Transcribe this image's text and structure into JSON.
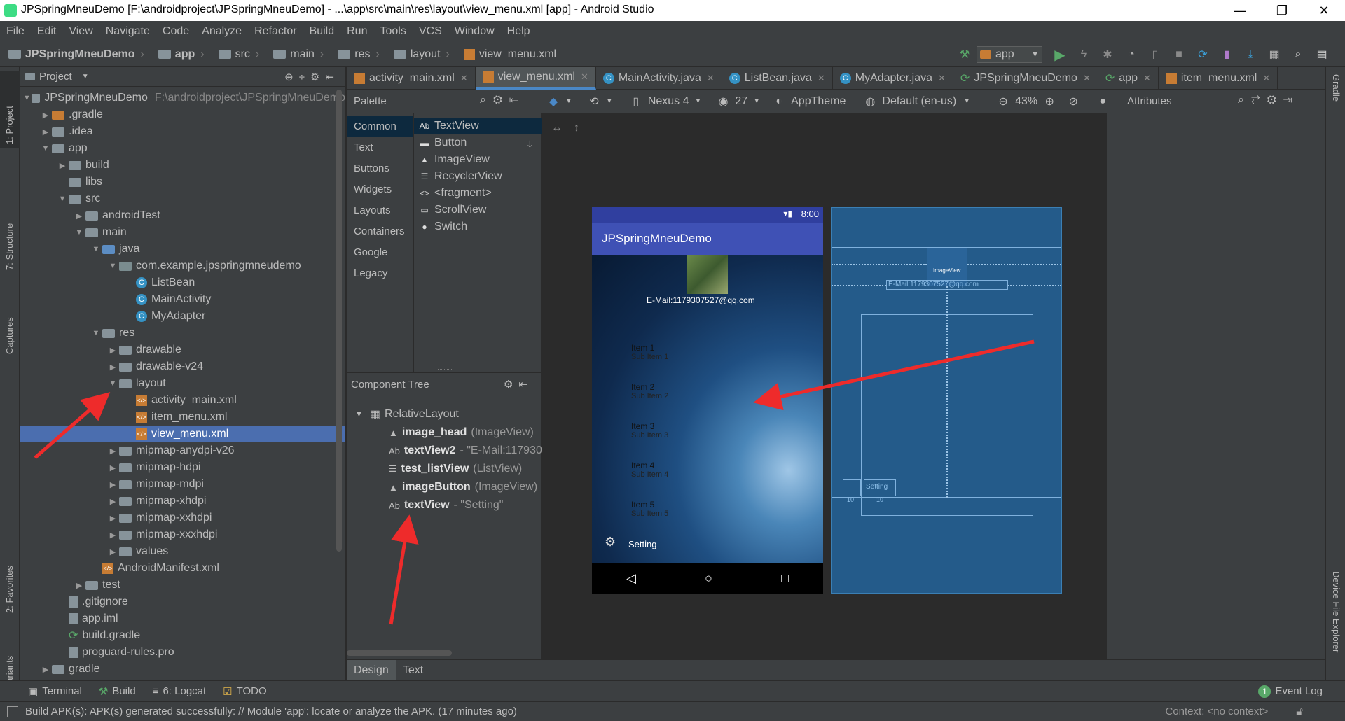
{
  "window": {
    "title": "JPSpringMneuDemo [F:\\androidproject\\JPSpringMneuDemo] - ...\\app\\src\\main\\res\\layout\\view_menu.xml [app] - Android Studio",
    "minimize": "—",
    "maximize": "❐",
    "close": "✕"
  },
  "menu": [
    "File",
    "Edit",
    "View",
    "Navigate",
    "Code",
    "Analyze",
    "Refactor",
    "Build",
    "Run",
    "Tools",
    "VCS",
    "Window",
    "Help"
  ],
  "breadcrumbs": [
    "JPSpringMneuDemo",
    "app",
    "src",
    "main",
    "res",
    "layout",
    "view_menu.xml"
  ],
  "toolbar": {
    "run_config": "app"
  },
  "left_tools": [
    "1: Project",
    "7: Structure",
    "Captures",
    "2: Favorites",
    "Build Variants"
  ],
  "right_tools": [
    "Gradle",
    "Device File Explorer"
  ],
  "project": {
    "header": "Project",
    "tree": [
      {
        "label": "JPSpringMneuDemo",
        "extra": "F:\\androidproject\\JPSpringMneuDemo",
        "type": "root"
      },
      {
        "label": ".gradle",
        "type": "folder-orange"
      },
      {
        "label": ".idea",
        "type": "folder"
      },
      {
        "label": "app",
        "type": "folder"
      },
      {
        "label": "build",
        "type": "folder"
      },
      {
        "label": "libs",
        "type": "folder"
      },
      {
        "label": "src",
        "type": "folder"
      },
      {
        "label": "androidTest",
        "type": "folder"
      },
      {
        "label": "main",
        "type": "folder"
      },
      {
        "label": "java",
        "type": "folder-blue"
      },
      {
        "label": "com.example.jpspringmneudemo",
        "type": "package"
      },
      {
        "label": "ListBean",
        "type": "class"
      },
      {
        "label": "MainActivity",
        "type": "class"
      },
      {
        "label": "MyAdapter",
        "type": "class"
      },
      {
        "label": "res",
        "type": "folder"
      },
      {
        "label": "drawable",
        "type": "folder"
      },
      {
        "label": "drawable-v24",
        "type": "folder"
      },
      {
        "label": "layout",
        "type": "folder"
      },
      {
        "label": "activity_main.xml",
        "type": "xml"
      },
      {
        "label": "item_menu.xml",
        "type": "xml"
      },
      {
        "label": "view_menu.xml",
        "type": "xml"
      },
      {
        "label": "mipmap-anydpi-v26",
        "type": "folder"
      },
      {
        "label": "mipmap-hdpi",
        "type": "folder"
      },
      {
        "label": "mipmap-mdpi",
        "type": "folder"
      },
      {
        "label": "mipmap-xhdpi",
        "type": "folder"
      },
      {
        "label": "mipmap-xxhdpi",
        "type": "folder"
      },
      {
        "label": "mipmap-xxxhdpi",
        "type": "folder"
      },
      {
        "label": "values",
        "type": "folder"
      },
      {
        "label": "AndroidManifest.xml",
        "type": "xml"
      },
      {
        "label": "test",
        "type": "folder"
      },
      {
        "label": ".gitignore",
        "type": "file"
      },
      {
        "label": "app.iml",
        "type": "file"
      },
      {
        "label": "build.gradle",
        "type": "gradle"
      },
      {
        "label": "proguard-rules.pro",
        "type": "file"
      },
      {
        "label": "gradle",
        "type": "folder"
      }
    ]
  },
  "tabs": [
    "activity_main.xml",
    "view_menu.xml",
    "MainActivity.java",
    "ListBean.java",
    "MyAdapter.java",
    "JPSpringMneuDemo",
    "app",
    "item_menu.xml"
  ],
  "design_toolbar": {
    "device": "Nexus 4",
    "api": "27",
    "theme": "AppTheme",
    "locale": "Default (en-us)",
    "zoom": "43%"
  },
  "palette": {
    "title": "Palette",
    "categories": [
      "Common",
      "Text",
      "Buttons",
      "Widgets",
      "Layouts",
      "Containers",
      "Google",
      "Legacy"
    ],
    "items": [
      {
        "icon": "Ab",
        "label": "TextView"
      },
      {
        "icon": "▬",
        "label": "Button"
      },
      {
        "icon": "▲",
        "label": "ImageView"
      },
      {
        "icon": "☰",
        "label": "RecyclerView"
      },
      {
        "icon": "<>",
        "label": "<fragment>"
      },
      {
        "icon": "▭",
        "label": "ScrollView"
      },
      {
        "icon": "●",
        "label": "Switch"
      }
    ]
  },
  "component_tree": {
    "title": "Component Tree",
    "root": "RelativeLayout",
    "items": [
      {
        "icon": "▲",
        "id": "image_head",
        "desc": "(ImageView)"
      },
      {
        "icon": "Ab",
        "id": "textView2",
        "desc": "- \"E-Mail:117930"
      },
      {
        "icon": "☰",
        "id": "test_listView",
        "desc": "(ListView)"
      },
      {
        "icon": "▲",
        "id": "imageButton",
        "desc": "(ImageView)"
      },
      {
        "icon": "Ab",
        "id": "textView",
        "desc": "- \"Setting\""
      }
    ]
  },
  "attributes": {
    "title": "Attributes"
  },
  "phone": {
    "time": "8:00",
    "app_title": "JPSpringMneuDemo",
    "email": "E-Mail:1179307527@qq.com",
    "items": [
      {
        "title": "Item 1",
        "sub": "Sub Item 1"
      },
      {
        "title": "Item 2",
        "sub": "Sub Item 2"
      },
      {
        "title": "Item 3",
        "sub": "Sub Item 3"
      },
      {
        "title": "Item 4",
        "sub": "Sub Item 4"
      },
      {
        "title": "Item 5",
        "sub": "Sub Item 5"
      }
    ],
    "setting": "Setting"
  },
  "blueprint": {
    "image_label": "ImageView",
    "email": "E-Mail:1179307527@qq.com",
    "setting": "Setting",
    "anchors": [
      "10",
      "10"
    ]
  },
  "design_tabs": [
    "Design",
    "Text"
  ],
  "bottom_tools": [
    {
      "icon": "▣",
      "label": "Terminal"
    },
    {
      "icon": "⚒",
      "label": "Build"
    },
    {
      "icon": "≡",
      "label": "6: Logcat"
    },
    {
      "icon": "☑",
      "label": "TODO"
    }
  ],
  "event_log": {
    "badge": "1",
    "label": "Event Log"
  },
  "status": {
    "message": "Build APK(s): APK(s) generated successfully: // Module 'app': locate or analyze the APK. (17 minutes ago)",
    "context": "Context: <no context>"
  }
}
